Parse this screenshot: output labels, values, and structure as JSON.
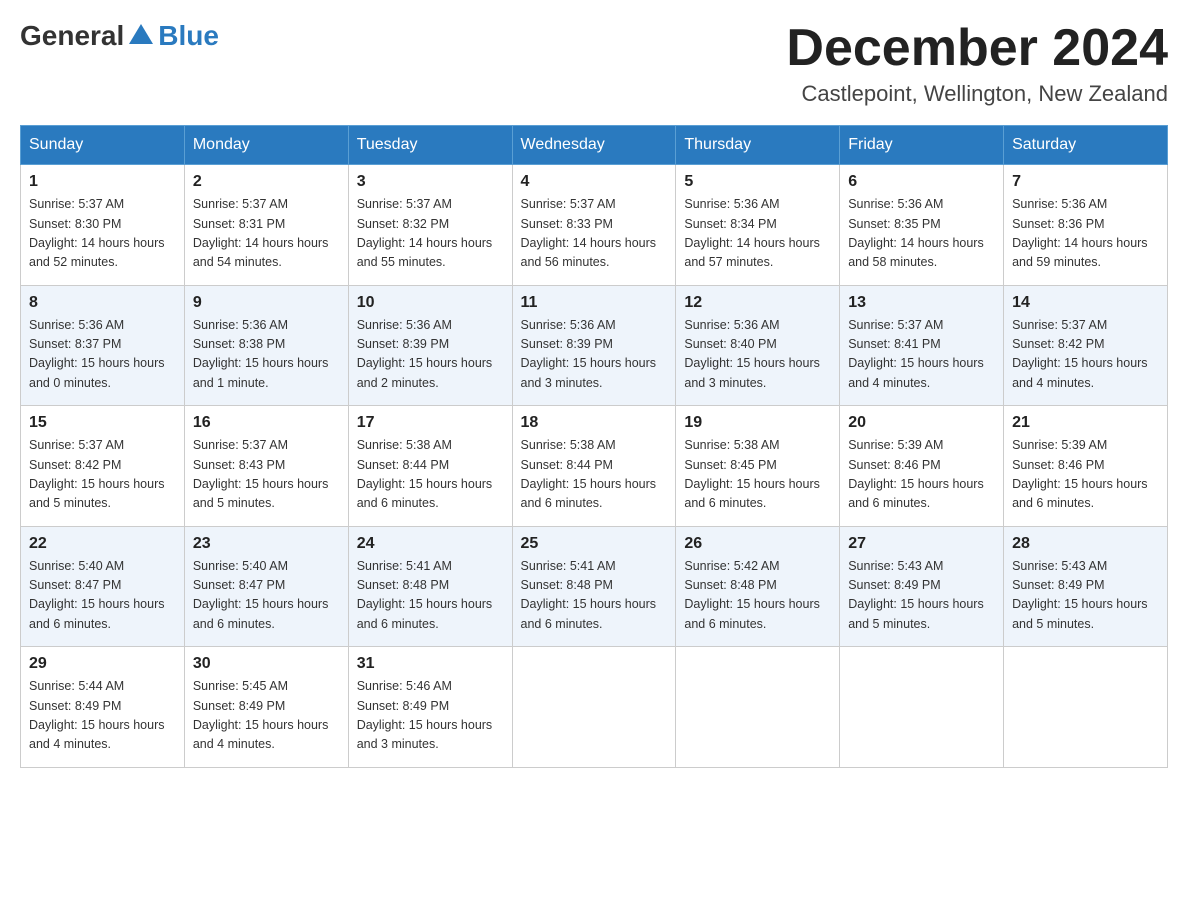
{
  "header": {
    "logo_general": "General",
    "logo_blue": "Blue",
    "month": "December 2024",
    "location": "Castlepoint, Wellington, New Zealand"
  },
  "weekdays": [
    "Sunday",
    "Monday",
    "Tuesday",
    "Wednesday",
    "Thursday",
    "Friday",
    "Saturday"
  ],
  "weeks": [
    [
      {
        "day": "1",
        "sunrise": "5:37 AM",
        "sunset": "8:30 PM",
        "daylight": "14 hours and 52 minutes."
      },
      {
        "day": "2",
        "sunrise": "5:37 AM",
        "sunset": "8:31 PM",
        "daylight": "14 hours and 54 minutes."
      },
      {
        "day": "3",
        "sunrise": "5:37 AM",
        "sunset": "8:32 PM",
        "daylight": "14 hours and 55 minutes."
      },
      {
        "day": "4",
        "sunrise": "5:37 AM",
        "sunset": "8:33 PM",
        "daylight": "14 hours and 56 minutes."
      },
      {
        "day": "5",
        "sunrise": "5:36 AM",
        "sunset": "8:34 PM",
        "daylight": "14 hours and 57 minutes."
      },
      {
        "day": "6",
        "sunrise": "5:36 AM",
        "sunset": "8:35 PM",
        "daylight": "14 hours and 58 minutes."
      },
      {
        "day": "7",
        "sunrise": "5:36 AM",
        "sunset": "8:36 PM",
        "daylight": "14 hours and 59 minutes."
      }
    ],
    [
      {
        "day": "8",
        "sunrise": "5:36 AM",
        "sunset": "8:37 PM",
        "daylight": "15 hours and 0 minutes."
      },
      {
        "day": "9",
        "sunrise": "5:36 AM",
        "sunset": "8:38 PM",
        "daylight": "15 hours and 1 minute."
      },
      {
        "day": "10",
        "sunrise": "5:36 AM",
        "sunset": "8:39 PM",
        "daylight": "15 hours and 2 minutes."
      },
      {
        "day": "11",
        "sunrise": "5:36 AM",
        "sunset": "8:39 PM",
        "daylight": "15 hours and 3 minutes."
      },
      {
        "day": "12",
        "sunrise": "5:36 AM",
        "sunset": "8:40 PM",
        "daylight": "15 hours and 3 minutes."
      },
      {
        "day": "13",
        "sunrise": "5:37 AM",
        "sunset": "8:41 PM",
        "daylight": "15 hours and 4 minutes."
      },
      {
        "day": "14",
        "sunrise": "5:37 AM",
        "sunset": "8:42 PM",
        "daylight": "15 hours and 4 minutes."
      }
    ],
    [
      {
        "day": "15",
        "sunrise": "5:37 AM",
        "sunset": "8:42 PM",
        "daylight": "15 hours and 5 minutes."
      },
      {
        "day": "16",
        "sunrise": "5:37 AM",
        "sunset": "8:43 PM",
        "daylight": "15 hours and 5 minutes."
      },
      {
        "day": "17",
        "sunrise": "5:38 AM",
        "sunset": "8:44 PM",
        "daylight": "15 hours and 6 minutes."
      },
      {
        "day": "18",
        "sunrise": "5:38 AM",
        "sunset": "8:44 PM",
        "daylight": "15 hours and 6 minutes."
      },
      {
        "day": "19",
        "sunrise": "5:38 AM",
        "sunset": "8:45 PM",
        "daylight": "15 hours and 6 minutes."
      },
      {
        "day": "20",
        "sunrise": "5:39 AM",
        "sunset": "8:46 PM",
        "daylight": "15 hours and 6 minutes."
      },
      {
        "day": "21",
        "sunrise": "5:39 AM",
        "sunset": "8:46 PM",
        "daylight": "15 hours and 6 minutes."
      }
    ],
    [
      {
        "day": "22",
        "sunrise": "5:40 AM",
        "sunset": "8:47 PM",
        "daylight": "15 hours and 6 minutes."
      },
      {
        "day": "23",
        "sunrise": "5:40 AM",
        "sunset": "8:47 PM",
        "daylight": "15 hours and 6 minutes."
      },
      {
        "day": "24",
        "sunrise": "5:41 AM",
        "sunset": "8:48 PM",
        "daylight": "15 hours and 6 minutes."
      },
      {
        "day": "25",
        "sunrise": "5:41 AM",
        "sunset": "8:48 PM",
        "daylight": "15 hours and 6 minutes."
      },
      {
        "day": "26",
        "sunrise": "5:42 AM",
        "sunset": "8:48 PM",
        "daylight": "15 hours and 6 minutes."
      },
      {
        "day": "27",
        "sunrise": "5:43 AM",
        "sunset": "8:49 PM",
        "daylight": "15 hours and 5 minutes."
      },
      {
        "day": "28",
        "sunrise": "5:43 AM",
        "sunset": "8:49 PM",
        "daylight": "15 hours and 5 minutes."
      }
    ],
    [
      {
        "day": "29",
        "sunrise": "5:44 AM",
        "sunset": "8:49 PM",
        "daylight": "15 hours and 4 minutes."
      },
      {
        "day": "30",
        "sunrise": "5:45 AM",
        "sunset": "8:49 PM",
        "daylight": "15 hours and 4 minutes."
      },
      {
        "day": "31",
        "sunrise": "5:46 AM",
        "sunset": "8:49 PM",
        "daylight": "15 hours and 3 minutes."
      },
      null,
      null,
      null,
      null
    ]
  ],
  "labels": {
    "sunrise": "Sunrise:",
    "sunset": "Sunset:",
    "daylight": "Daylight:"
  }
}
